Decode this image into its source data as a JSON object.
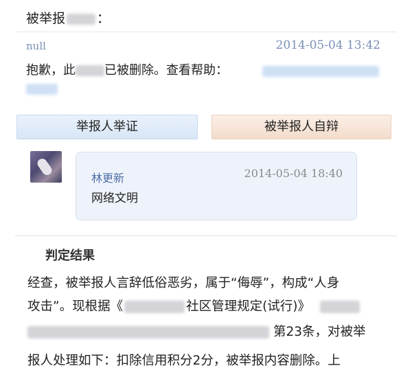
{
  "report": {
    "header_label": "被举报",
    "header_colon": "：",
    "user": "null",
    "time": "2014-05-04 13:42",
    "deleted_prefix": "抱歉，此",
    "deleted_suffix": "已被删除。查看帮助："
  },
  "tabs": {
    "reporter_evidence": "举报人举证",
    "reported_defense": "被举报人自辩"
  },
  "comment": {
    "author": "林更新",
    "time": "2014-05-04 18:40",
    "body": "网络文明"
  },
  "verdict": {
    "title": "判定结果",
    "line1": "经查，被举报人言辞低俗恶劣，属于“侮辱”，构成“人身",
    "line2_prefix": "攻击”。现根据《",
    "line2_rule": "社区管理规定(试行)》",
    "line3_suffix": "第23条，对被举",
    "line4": "报人处理如下：扣除信用积分2分，被举报内容删除。上"
  },
  "colors": {
    "link_blue": "#7a8fb5",
    "author_blue": "#4f6fa7",
    "tab_blue": "#d7e6f7",
    "tab_peach": "#f3dccb",
    "card_bg": "#eef3fb"
  }
}
